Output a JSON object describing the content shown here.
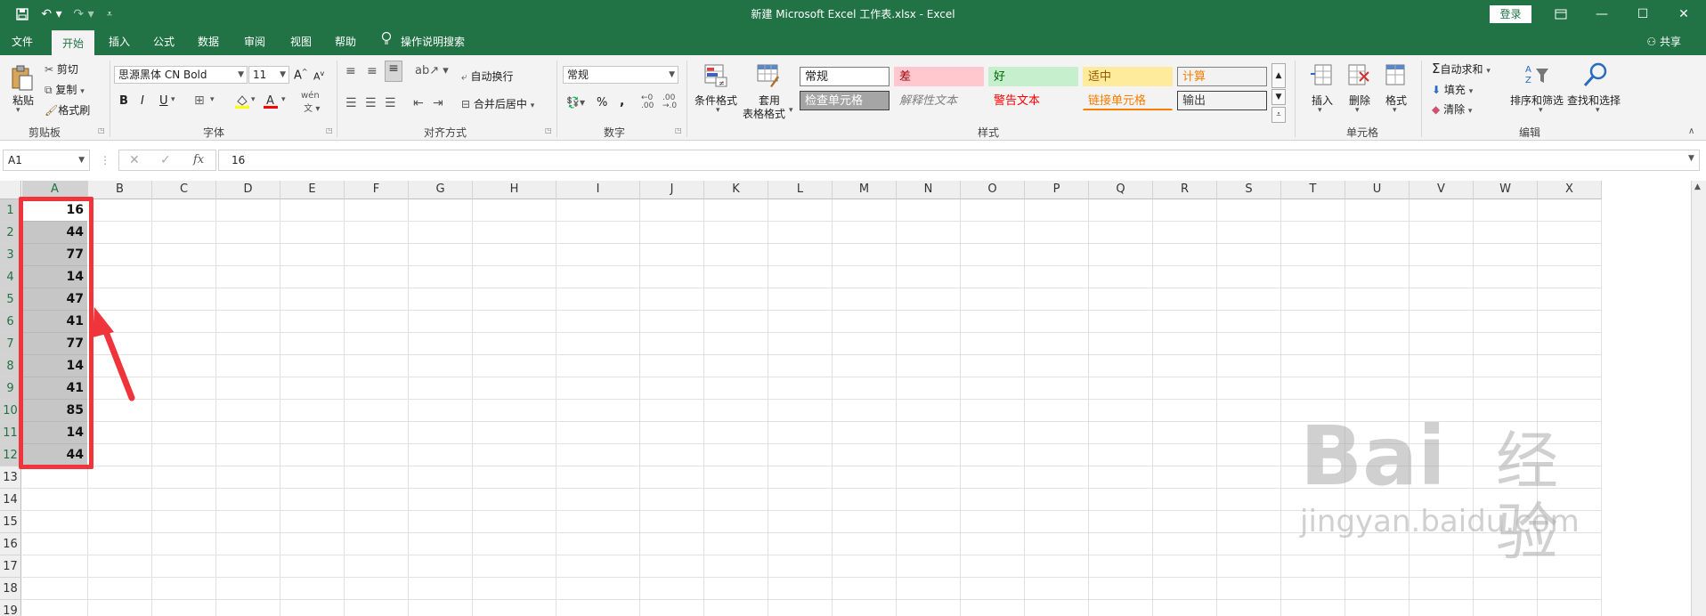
{
  "titlebar": {
    "title": "新建 Microsoft Excel 工作表.xlsx  -  Excel",
    "login": "登录",
    "save_icon": "save-icon",
    "undo_icon": "undo-icon",
    "redo_icon": "redo-icon"
  },
  "tabs": [
    "文件",
    "开始",
    "插入",
    "公式",
    "数据",
    "审阅",
    "视图",
    "帮助"
  ],
  "tell_me": "操作说明搜索",
  "share": "共享",
  "ribbon": {
    "clipboard": {
      "paste": "粘贴",
      "cut": "剪切",
      "copy": "复制",
      "format_painter": "格式刷",
      "label": "剪贴板"
    },
    "font": {
      "name": "思源黑体 CN Bold",
      "size": "11",
      "bold": "B",
      "italic": "I",
      "underline": "U",
      "label": "字体"
    },
    "alignment": {
      "wrap": "自动换行",
      "merge": "合并后居中",
      "label": "对齐方式"
    },
    "number": {
      "format": "常规",
      "label": "数字"
    },
    "styles": {
      "conditional": "条件格式",
      "table_format_1": "套用",
      "table_format_2": "表格格式",
      "cells": [
        {
          "text": "常规",
          "bg": "#ffffff",
          "fg": "#222222",
          "border": "#7a7a7a"
        },
        {
          "text": "差",
          "bg": "#ffc7ce",
          "fg": "#9c0006",
          "border": "none"
        },
        {
          "text": "好",
          "bg": "#c6efce",
          "fg": "#006100",
          "border": "none"
        },
        {
          "text": "适中",
          "bg": "#ffeb9c",
          "fg": "#9c5700",
          "border": "none"
        },
        {
          "text": "计算",
          "bg": "#f2f2f2",
          "fg": "#fa7d00",
          "border": "#7f7f7f"
        },
        {
          "text": "检查单元格",
          "bg": "#a5a5a5",
          "fg": "#ffffff",
          "border": "#3f3f3f"
        },
        {
          "text": "解释性文本",
          "bg": "transparent",
          "fg": "#7f7f7f",
          "border": "none"
        },
        {
          "text": "警告文本",
          "bg": "transparent",
          "fg": "#ff0000",
          "border": "none"
        },
        {
          "text": "链接单元格",
          "bg": "transparent",
          "fg": "#fa7d00",
          "border": "none"
        },
        {
          "text": "输出",
          "bg": "#f2f2f2",
          "fg": "#3f3f3f",
          "border": "#3f3f3f"
        }
      ],
      "label": "样式"
    },
    "cells_group": {
      "insert": "插入",
      "delete": "删除",
      "format": "格式",
      "label": "单元格"
    },
    "editing": {
      "autosum": "自动求和",
      "fill": "填充",
      "clear": "清除",
      "sort": "排序和筛选",
      "find": "查找和选择",
      "label": "编辑"
    }
  },
  "formula_bar": {
    "name_box": "A1",
    "fx": "fx",
    "value": "16"
  },
  "sheet": {
    "columns": [
      "A",
      "B",
      "C",
      "D",
      "E",
      "F",
      "G",
      "H",
      "I",
      "J",
      "K",
      "L",
      "M",
      "N",
      "O",
      "P",
      "Q",
      "R",
      "S",
      "T",
      "U",
      "V",
      "W",
      "X"
    ],
    "rows": [
      "1",
      "2",
      "3",
      "4",
      "5",
      "6",
      "7",
      "8",
      "9",
      "10",
      "11",
      "12",
      "13",
      "14",
      "15",
      "16",
      "17",
      "18",
      "19"
    ],
    "column_a_values": [
      "16",
      "44",
      "77",
      "14",
      "47",
      "41",
      "77",
      "14",
      "41",
      "85",
      "14",
      "44"
    ],
    "selected_column": "A",
    "selected_rows": [
      "1",
      "2",
      "3",
      "4",
      "5",
      "6",
      "7",
      "8",
      "9",
      "10",
      "11",
      "12"
    ]
  },
  "watermark": {
    "line1": "Bai",
    "line2": "经验",
    "line3": "jingyan.baidu.com"
  }
}
